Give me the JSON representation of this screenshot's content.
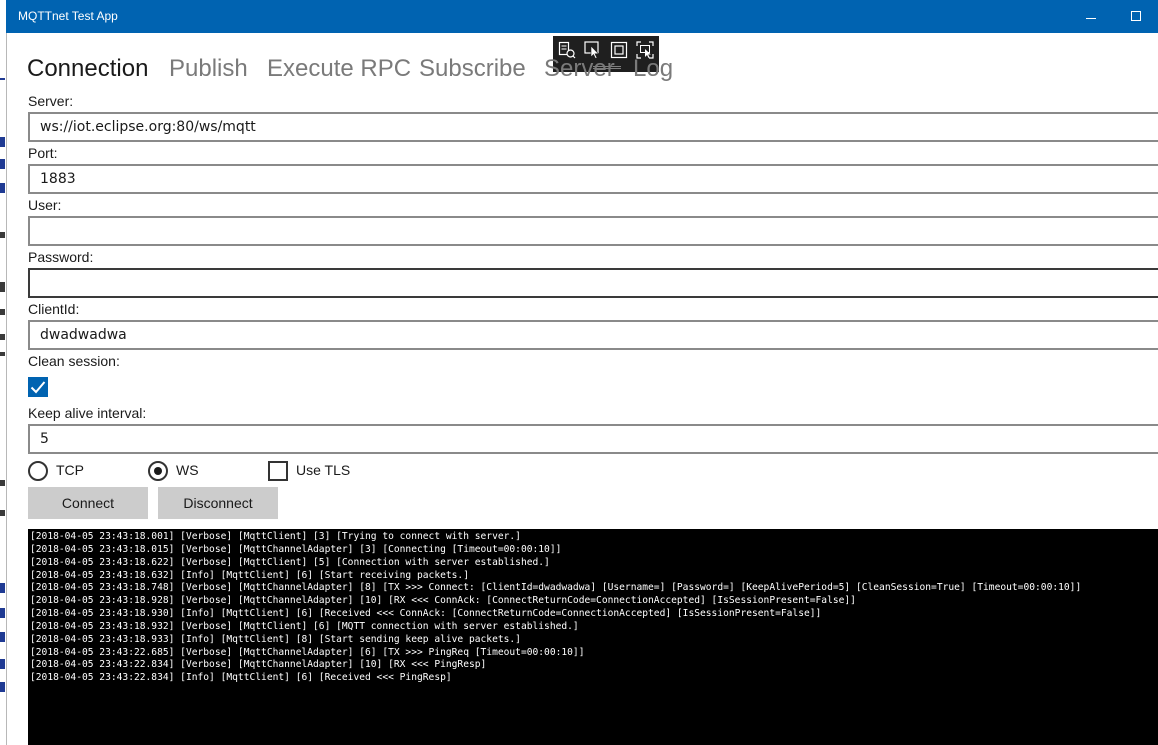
{
  "window": {
    "title": "MQTTnet Test App"
  },
  "tabs": [
    {
      "label": "Connection",
      "active": true
    },
    {
      "label": "Publish",
      "active": false
    },
    {
      "label": "Execute RPC",
      "active": false
    },
    {
      "label": "Subscribe",
      "active": false
    },
    {
      "label": "Server",
      "active": false
    },
    {
      "label": "Log",
      "active": false
    }
  ],
  "form": {
    "server_label": "Server:",
    "server_value": "ws://iot.eclipse.org:80/ws/mqtt",
    "port_label": "Port:",
    "port_value": "1883",
    "user_label": "User:",
    "user_value": "",
    "password_label": "Password:",
    "password_value": "",
    "clientid_label": "ClientId:",
    "clientid_value": "dwadwadwa",
    "clean_session_label": "Clean session:",
    "clean_session_checked": true,
    "keepalive_label": "Keep alive interval:",
    "keepalive_value": "5"
  },
  "transport": {
    "tcp_label": "TCP",
    "ws_label": "WS",
    "selected": "WS",
    "tls_label": "Use TLS",
    "tls_checked": false
  },
  "buttons": {
    "connect_label": "Connect",
    "disconnect_label": "Disconnect"
  },
  "log": [
    "[2018-04-05 23:43:18.001] [Verbose] [MqttClient] [3] [Trying to connect with server.]",
    "[2018-04-05 23:43:18.015] [Verbose] [MqttChannelAdapter] [3] [Connecting [Timeout=00:00:10]]",
    "[2018-04-05 23:43:18.622] [Verbose] [MqttClient] [5] [Connection with server established.]",
    "[2018-04-05 23:43:18.632] [Info] [MqttClient] [6] [Start receiving packets.]",
    "[2018-04-05 23:43:18.748] [Verbose] [MqttChannelAdapter] [8] [TX >>> Connect: [ClientId=dwadwadwa] [Username=] [Password=] [KeepAlivePeriod=5] [CleanSession=True] [Timeout=00:00:10]]",
    "[2018-04-05 23:43:18.928] [Verbose] [MqttChannelAdapter] [10] [RX <<< ConnAck: [ConnectReturnCode=ConnectionAccepted] [IsSessionPresent=False]]",
    "[2018-04-05 23:43:18.930] [Info] [MqttClient] [6] [Received <<< ConnAck: [ConnectReturnCode=ConnectionAccepted] [IsSessionPresent=False]]",
    "[2018-04-05 23:43:18.932] [Verbose] [MqttClient] [6] [MQTT connection with server established.]",
    "[2018-04-05 23:43:18.933] [Info] [MqttClient] [8] [Start sending keep alive packets.]",
    "[2018-04-05 23:43:22.685] [Verbose] [MqttChannelAdapter] [6] [TX >>> PingReq [Timeout=00:00:10]]",
    "[2018-04-05 23:43:22.834] [Verbose] [MqttChannelAdapter] [10] [RX <<< PingResp]",
    "[2018-04-05 23:43:22.834] [Info] [MqttClient] [6] [Received <<< PingResp]"
  ],
  "colors": {
    "accent": "#0063b1",
    "titlebar": "#0063b1",
    "log_bg": "#000000",
    "log_text": "#ffffff",
    "button_bg": "#cccccc"
  },
  "icons": {
    "toolbar": [
      "select-element-icon",
      "pointer-select-icon",
      "display-layout-adorners-icon",
      "track-focus-icon"
    ],
    "window_controls": [
      "minimize-icon",
      "maximize-icon"
    ]
  }
}
